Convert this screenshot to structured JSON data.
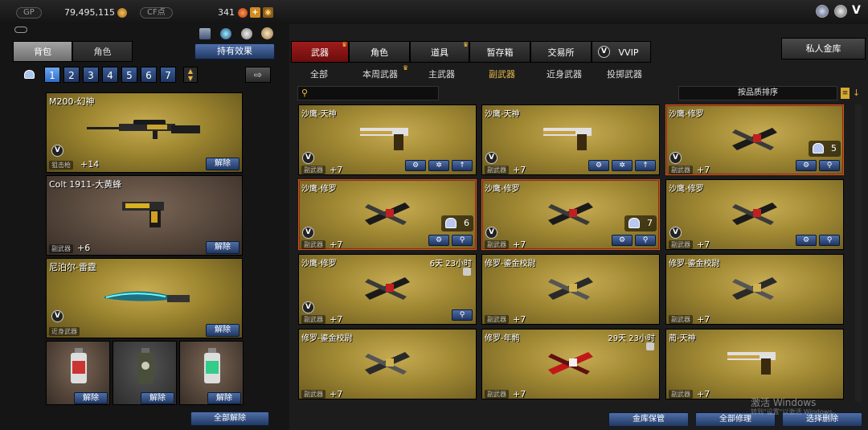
{
  "topbar": {
    "gp_label": "GP",
    "gp_value": "79,495,115",
    "cf_label": "CF点",
    "cf_value": "341"
  },
  "left": {
    "tabs": [
      "背包",
      "角色"
    ],
    "effect_button": "持有效果",
    "pages": [
      "1",
      "2",
      "3",
      "4",
      "5",
      "6",
      "7"
    ],
    "active_page": "1",
    "slots": [
      {
        "title": "M200-幻神",
        "type": "狙击枪",
        "plus": "+14",
        "button": "解除",
        "style": "gold",
        "vip": true
      },
      {
        "title": "Colt 1911-大黄蜂",
        "type": "副武器",
        "plus": "+6",
        "button": "解除",
        "style": "brown",
        "vip": false
      },
      {
        "title": "尼泊尔-雷霆",
        "type": "近身武器",
        "plus": "",
        "button": "解除",
        "style": "gold",
        "vip": true
      }
    ],
    "grenades": [
      {
        "button": "解除"
      },
      {
        "button": "解除"
      },
      {
        "button": "解除"
      }
    ],
    "unequip_all": "全部解除"
  },
  "right": {
    "tabs": [
      "武器",
      "角色",
      "道具",
      "暂存箱",
      "交易所",
      "VVIP"
    ],
    "active_tab": "武器",
    "private_vault": "私人金库",
    "subtabs": [
      "全部",
      "本周武器",
      "主武器",
      "副武器",
      "近身武器",
      "投掷武器"
    ],
    "active_subtab": "副武器",
    "sort_label": "按品质排序",
    "cards": [
      {
        "title": "沙鹰-天神",
        "type": "副武器",
        "plus": "+7",
        "icons": [
          "gear-plus",
          "gear",
          "arrow-up"
        ],
        "gun": "silver",
        "vip": true
      },
      {
        "title": "沙鹰-天神",
        "type": "副武器",
        "plus": "+7",
        "icons": [
          "gear-plus",
          "gear",
          "arrow-up"
        ],
        "gun": "silver",
        "vip": true
      },
      {
        "title": "沙鹰-修罗",
        "type": "副武器",
        "plus": "+7",
        "icons": [
          "gear-plus",
          "search"
        ],
        "gun": "dark",
        "vip": true,
        "count": "5",
        "selected": true
      },
      {
        "title": "沙鹰-修罗",
        "type": "副武器",
        "plus": "+7",
        "icons": [
          "gear-plus",
          "search"
        ],
        "gun": "dark",
        "vip": true,
        "count": "6",
        "selected": true
      },
      {
        "title": "沙鹰-修罗",
        "type": "副武器",
        "plus": "+7",
        "icons": [
          "gear-plus",
          "search"
        ],
        "gun": "dark",
        "vip": true,
        "count": "7",
        "selected": true
      },
      {
        "title": "沙鹰-修罗",
        "type": "副武器",
        "plus": "+7",
        "icons": [
          "gear-plus",
          "search"
        ],
        "gun": "dark",
        "vip": true
      },
      {
        "title": "沙鹰-修罗",
        "type": "副武器",
        "plus": "+7",
        "icons": [
          "search"
        ],
        "gun": "dark",
        "vip": true,
        "time": "6天 23小时"
      },
      {
        "title": "修罗-鎏金校尉",
        "type": "副武器",
        "plus": "+7",
        "icons": [],
        "gun": "cross"
      },
      {
        "title": "修罗-鎏金校尉",
        "type": "副武器",
        "plus": "+7",
        "icons": [],
        "gun": "cross"
      },
      {
        "title": "修罗-鎏金校尉",
        "type": "副武器",
        "plus": "+7",
        "icons": [],
        "gun": "cross"
      },
      {
        "title": "修罗-年鹘",
        "type": "副武器",
        "plus": "+7",
        "icons": [],
        "gun": "red",
        "time": "29天 23小时"
      },
      {
        "title": "蔺-天神",
        "type": "副武器",
        "plus": "+7",
        "icons": [],
        "gun": "silver"
      }
    ],
    "bottom_buttons": [
      "金库保管",
      "全部修理",
      "选择删除"
    ]
  },
  "watermark": {
    "line1": "激活 Windows",
    "line2": "转到\"设置\"以激活 Windows。"
  },
  "colors": {
    "gold_card": "#a08833",
    "selected_border": "#c9561e",
    "blue_button": "#2d4c86",
    "active_tab_red": "#8a1414"
  }
}
